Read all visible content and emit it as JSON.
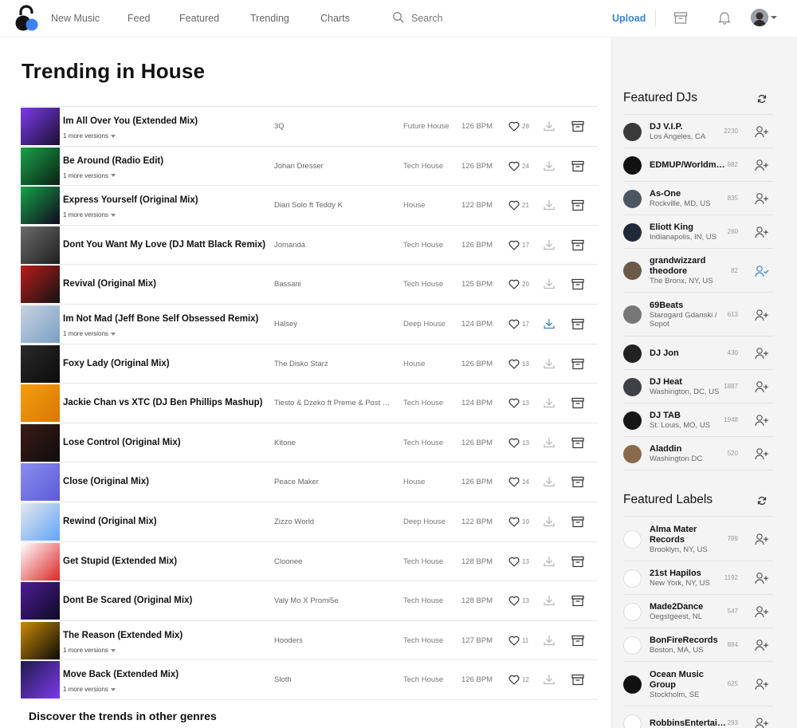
{
  "nav": {
    "items": [
      "New Music",
      "Feed",
      "Featured",
      "Trending",
      "Charts"
    ],
    "search_placeholder": "Search",
    "upload": "Upload"
  },
  "page": {
    "title": "Trending in House",
    "discover": "Discover the trends in other genres"
  },
  "tracks": [
    {
      "title": "Im All Over You (Extended Mix)",
      "versions": "1 more versions",
      "artist": "3Q",
      "genre": "Future House",
      "bpm": "126 BPM",
      "likes": "28",
      "cover": "#7c3aed",
      "cover2": "#1a0f2e",
      "downloaded": false
    },
    {
      "title": "Be Around (Radio Edit)",
      "versions": "1 more versions",
      "artist": "Johan Dresser",
      "genre": "Tech House",
      "bpm": "126 BPM",
      "likes": "24",
      "cover": "#18a34a",
      "cover2": "#0b1f12",
      "downloaded": false
    },
    {
      "title": "Express Yourself (Original Mix)",
      "versions": "1 more versions",
      "artist": "Dian Solo ft Teddy K",
      "genre": "House",
      "bpm": "122 BPM",
      "likes": "21",
      "cover": "#16a34a",
      "cover2": "#12071e",
      "downloaded": false
    },
    {
      "title": "Dont You Want My Love (DJ Matt Black Remix)",
      "versions": "",
      "artist": "Jomanda",
      "genre": "Tech House",
      "bpm": "126 BPM",
      "likes": "17",
      "cover": "#6b6b6b",
      "cover2": "#1f1f1f",
      "downloaded": false
    },
    {
      "title": "Revival (Original Mix)",
      "versions": "",
      "artist": "Bassani",
      "genre": "Tech House",
      "bpm": "125 BPM",
      "likes": "20",
      "cover": "#b91c1c",
      "cover2": "#121212",
      "downloaded": false
    },
    {
      "title": "Im Not Mad (Jeff Bone Self Obsessed Remix)",
      "versions": "1 more versions",
      "artist": "Halsey",
      "genre": "Deep House",
      "bpm": "124 BPM",
      "likes": "17",
      "cover": "#c7d2e0",
      "cover2": "#7aa0c4",
      "downloaded": true
    },
    {
      "title": "Foxy Lady (Original Mix)",
      "versions": "",
      "artist": "The Disko Starz",
      "genre": "House",
      "bpm": "126 BPM",
      "likes": "13",
      "cover": "#2a2a2a",
      "cover2": "#0b0b0b",
      "downloaded": false
    },
    {
      "title": "Jackie Chan vs XTC (DJ Ben Phillips Mashup)",
      "versions": "",
      "artist": "Tiesto & Dzeko ft Preme & Post Malone",
      "genre": "Tech House",
      "bpm": "124 BPM",
      "likes": "13",
      "cover": "#f59e0b",
      "cover2": "#d97706",
      "downloaded": false
    },
    {
      "title": "Lose Control (Original Mix)",
      "versions": "",
      "artist": "Kitone",
      "genre": "Tech House",
      "bpm": "126 BPM",
      "likes": "13",
      "cover": "#3a1a14",
      "cover2": "#0e0e0e",
      "downloaded": false
    },
    {
      "title": "Close (Original Mix)",
      "versions": "",
      "artist": "Peace Maker",
      "genre": "House",
      "bpm": "126 BPM",
      "likes": "14",
      "cover": "#8b8cf0",
      "cover2": "#5b5bd6",
      "downloaded": false
    },
    {
      "title": "Rewind (Original Mix)",
      "versions": "",
      "artist": "Zizzo World",
      "genre": "Deep House",
      "bpm": "122 BPM",
      "likes": "10",
      "cover": "#e5e7eb",
      "cover2": "#60a5fa",
      "downloaded": false
    },
    {
      "title": "Get Stupid (Extended Mix)",
      "versions": "",
      "artist": "Cloonee",
      "genre": "Tech House",
      "bpm": "128 BPM",
      "likes": "13",
      "cover": "#ffffff",
      "cover2": "#dc2626",
      "downloaded": false
    },
    {
      "title": "Dont Be Scared (Original Mix)",
      "versions": "",
      "artist": "Valy Mo X Promi5e",
      "genre": "Tech House",
      "bpm": "128 BPM",
      "likes": "13",
      "cover": "#4c1d95",
      "cover2": "#0f0a24",
      "downloaded": false
    },
    {
      "title": "The Reason (Extended Mix)",
      "versions": "1 more versions",
      "artist": "Hooders",
      "genre": "Tech House",
      "bpm": "127 BPM",
      "likes": "11",
      "cover": "#ca8a04",
      "cover2": "#0a0a0a",
      "downloaded": false
    },
    {
      "title": "Move Back (Extended Mix)",
      "versions": "1 more versions",
      "artist": "Sloth",
      "genre": "Tech House",
      "bpm": "126 BPM",
      "likes": "12",
      "cover": "#1e1b4b",
      "cover2": "#7c3aed",
      "downloaded": false
    }
  ],
  "featured_djs": {
    "title": "Featured DJs",
    "items": [
      {
        "name": "DJ V.I.P.",
        "location": "Los Angeles, CA",
        "count": "2230",
        "following": false,
        "color": "#3a3a3a"
      },
      {
        "name": "EDMUP/Worldmusic",
        "location": "",
        "count": "982",
        "following": false,
        "color": "#111111"
      },
      {
        "name": "As-One",
        "location": "Rockville, MD, US",
        "count": "835",
        "following": false,
        "color": "#4b5563"
      },
      {
        "name": "Eliott King",
        "location": "Indianapolis, IN, US",
        "count": "260",
        "following": false,
        "color": "#1f2937"
      },
      {
        "name": "grandwizzard theodore",
        "location": "The Bronx, NY, US",
        "count": "82",
        "following": true,
        "color": "#6b5a4a"
      },
      {
        "name": "69Beats",
        "location": "Starogard Gdanski / Sopot",
        "count": "613",
        "following": false,
        "color": "#777777"
      },
      {
        "name": "DJ Jon",
        "location": "",
        "count": "430",
        "following": false,
        "color": "#222222"
      },
      {
        "name": "DJ Heat",
        "location": "Washington, DC, US",
        "count": "1887",
        "following": false,
        "color": "#3f3f46"
      },
      {
        "name": "DJ TAB",
        "location": "St. Louis, MO, US",
        "count": "1948",
        "following": false,
        "color": "#161616"
      },
      {
        "name": "Aladdin",
        "location": "Washington DC",
        "count": "520",
        "following": false,
        "color": "#8a6a4a"
      }
    ]
  },
  "featured_labels": {
    "title": "Featured Labels",
    "items": [
      {
        "name": "Alma Mater Records",
        "location": "Brooklyn, NY, US",
        "count": "799",
        "color": "#ffffff"
      },
      {
        "name": "21st Hapilos",
        "location": "New York, NY, US",
        "count": "1192",
        "color": "#ffffff"
      },
      {
        "name": "Made2Dance",
        "location": "Oegstgeest, NL",
        "count": "547",
        "color": "#ffffff"
      },
      {
        "name": "BonFireRecords",
        "location": "Boston, MA, US",
        "count": "884",
        "color": "#ffffff"
      },
      {
        "name": "Ocean Music Group",
        "location": "Stockholm, SE",
        "count": "625",
        "color": "#111111"
      },
      {
        "name": "RobbinsEntertainment",
        "location": "",
        "count": "293",
        "color": "#ffffff"
      }
    ]
  }
}
